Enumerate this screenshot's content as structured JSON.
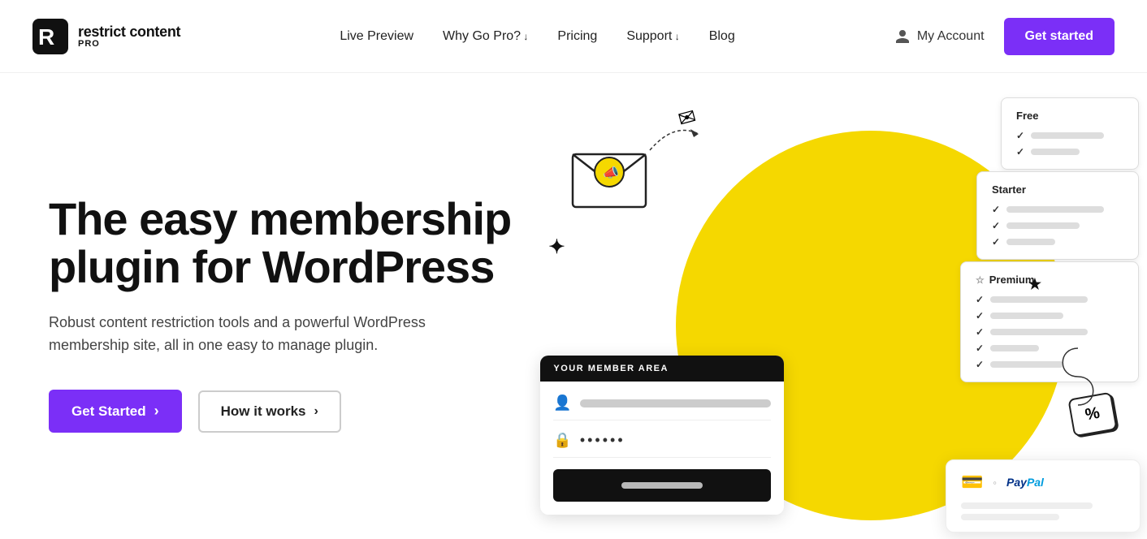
{
  "logo": {
    "icon_alt": "Restrict Content Pro Logo",
    "main_text": "restrict content",
    "pro_label": "PRO"
  },
  "nav": {
    "links": [
      {
        "label": "Live Preview",
        "has_dropdown": false
      },
      {
        "label": "Why Go Pro?",
        "has_dropdown": true
      },
      {
        "label": "Pricing",
        "has_dropdown": false
      },
      {
        "label": "Support",
        "has_dropdown": true
      },
      {
        "label": "Blog",
        "has_dropdown": false
      }
    ],
    "my_account": "My Account",
    "get_started": "Get started"
  },
  "hero": {
    "title": "The easy membership plugin for WordPress",
    "subtitle": "Robust content restriction tools and a powerful WordPress membership site, all in one easy to manage plugin.",
    "btn_primary": "Get Started",
    "btn_secondary": "How it works"
  },
  "illustration": {
    "member_area_header": "YOUR MEMBER AREA",
    "card_free_label": "Free",
    "card_starter_label": "Starter",
    "card_premium_label": "Premium",
    "paypal_label": "PayPal",
    "discount_label": "%"
  },
  "colors": {
    "accent_purple": "#7b2ff7",
    "yellow": "#f5d800",
    "dark": "#111111"
  }
}
